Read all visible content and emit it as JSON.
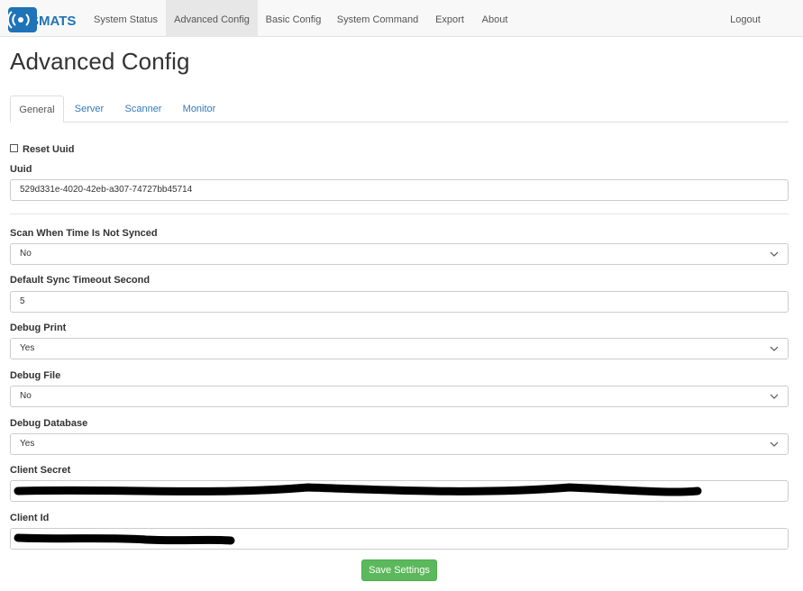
{
  "navbar": {
    "brand": "SMATS",
    "items": [
      {
        "label": "System Status"
      },
      {
        "label": "Advanced Config"
      },
      {
        "label": "Basic Config"
      },
      {
        "label": "System Command"
      },
      {
        "label": "Export"
      },
      {
        "label": "About"
      }
    ],
    "logout": "Logout"
  },
  "page": {
    "title": "Advanced Config"
  },
  "tabs": [
    {
      "label": "General"
    },
    {
      "label": "Server"
    },
    {
      "label": "Scanner"
    },
    {
      "label": "Monitor"
    }
  ],
  "form": {
    "reset_uuid": {
      "label": "Reset Uuid",
      "checked": false
    },
    "uuid": {
      "label": "Uuid",
      "value": "529d331e-4020-42eb-a307-74727bb45714"
    },
    "scan_when_not_synced": {
      "label": "Scan When Time Is Not Synced",
      "value": "No"
    },
    "default_sync_timeout": {
      "label": "Default Sync Timeout Second",
      "value": "5"
    },
    "debug_print": {
      "label": "Debug Print",
      "value": "Yes"
    },
    "debug_file": {
      "label": "Debug File",
      "value": "No"
    },
    "debug_database": {
      "label": "Debug Database",
      "value": "Yes"
    },
    "client_secret": {
      "label": "Client Secret"
    },
    "client_id": {
      "label": "Client Id"
    },
    "save_label": "Save Settings"
  },
  "colors": {
    "link": "#337ab7",
    "success": "#5cb85c",
    "logo_blue": "#1f73b7"
  }
}
